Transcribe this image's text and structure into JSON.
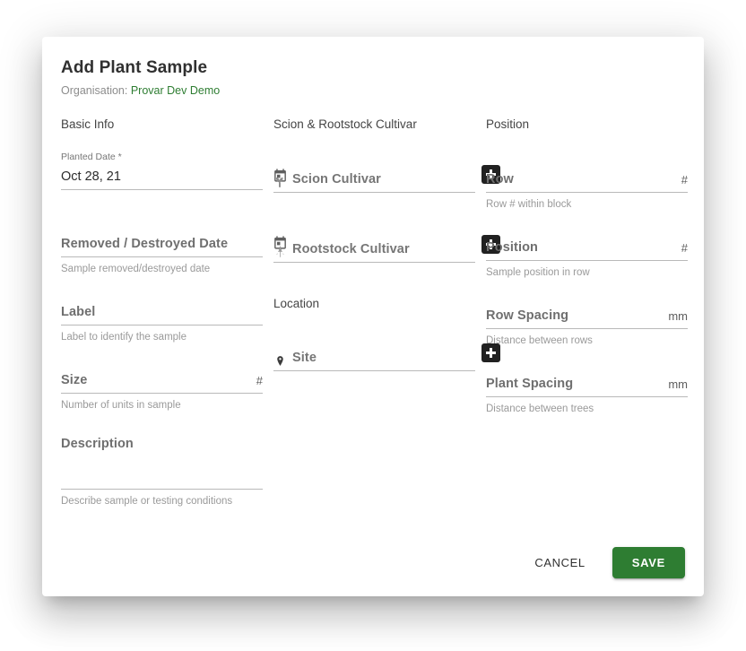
{
  "dialog": {
    "title": "Add Plant Sample",
    "organisation_label": "Organisation:",
    "organisation_value": "Provar Dev Demo",
    "accent_green": "#2e7d32",
    "org_text_color": "#2e7d32"
  },
  "sections": {
    "basic_info": "Basic Info",
    "scion_rootstock": "Scion & Rootstock Cultivar",
    "location": "Location",
    "position": "Position"
  },
  "fields": {
    "planted_date": {
      "label": "Planted Date *",
      "value": "Oct 28, 21",
      "icon": "calendar-icon",
      "hint": ""
    },
    "removed_date": {
      "placeholder": "Removed / Destroyed Date",
      "value": "",
      "icon": "calendar-icon",
      "hint": "Sample removed/destroyed date"
    },
    "label": {
      "placeholder": "Label",
      "value": "",
      "hint": "Label to identify the sample"
    },
    "size": {
      "placeholder": "Size",
      "value": "",
      "suffix": "#",
      "hint": "Number of units in sample"
    },
    "description": {
      "placeholder": "Description",
      "value": "",
      "hint": "Describe sample or testing conditions"
    },
    "scion_cultivar": {
      "placeholder": "Scion Cultivar",
      "value": "",
      "icon": "seedling-icon",
      "add_button": "+",
      "hint": ""
    },
    "rootstock_cultivar": {
      "placeholder": "Rootstock Cultivar",
      "value": "",
      "icon": "tree-icon",
      "add_button": "+",
      "hint": ""
    },
    "site": {
      "placeholder": "Site",
      "value": "",
      "icon": "map-pin-icon",
      "add_button": "+",
      "hint": ""
    },
    "row": {
      "placeholder": "Row",
      "value": "",
      "suffix": "#",
      "hint": "Row # within block"
    },
    "position": {
      "placeholder": "Position",
      "value": "",
      "suffix": "#",
      "hint": "Sample position in row"
    },
    "row_spacing": {
      "placeholder": "Row Spacing",
      "value": "",
      "suffix": "mm",
      "hint": "Distance between rows"
    },
    "plant_spacing": {
      "placeholder": "Plant Spacing",
      "value": "",
      "suffix": "mm",
      "hint": "Distance between trees"
    }
  },
  "footer": {
    "cancel_label": "CANCEL",
    "save_label": "SAVE"
  }
}
